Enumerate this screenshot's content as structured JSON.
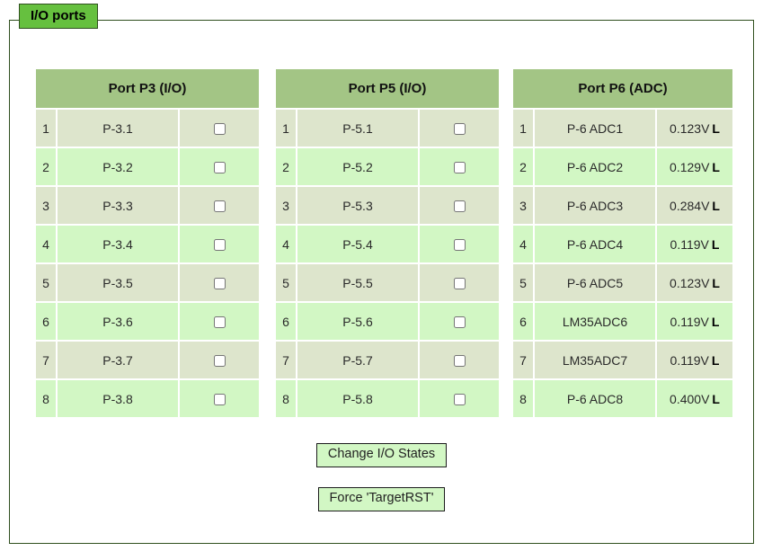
{
  "fieldset": {
    "legend": "I/O ports"
  },
  "tables": [
    {
      "id": "p3",
      "title": "Port P3 (I/O)",
      "type": "io",
      "rows": [
        {
          "index": "1",
          "name": "P-3.1",
          "checked": false
        },
        {
          "index": "2",
          "name": "P-3.2",
          "checked": false
        },
        {
          "index": "3",
          "name": "P-3.3",
          "checked": false
        },
        {
          "index": "4",
          "name": "P-3.4",
          "checked": false
        },
        {
          "index": "5",
          "name": "P-3.5",
          "checked": false
        },
        {
          "index": "6",
          "name": "P-3.6",
          "checked": false
        },
        {
          "index": "7",
          "name": "P-3.7",
          "checked": false
        },
        {
          "index": "8",
          "name": "P-3.8",
          "checked": false
        }
      ]
    },
    {
      "id": "p5",
      "title": "Port P5 (I/O)",
      "type": "io",
      "rows": [
        {
          "index": "1",
          "name": "P-5.1",
          "checked": false
        },
        {
          "index": "2",
          "name": "P-5.2",
          "checked": false
        },
        {
          "index": "3",
          "name": "P-5.3",
          "checked": false
        },
        {
          "index": "4",
          "name": "P-5.4",
          "checked": false
        },
        {
          "index": "5",
          "name": "P-5.5",
          "checked": false
        },
        {
          "index": "6",
          "name": "P-5.6",
          "checked": false
        },
        {
          "index": "7",
          "name": "P-5.7",
          "checked": false
        },
        {
          "index": "8",
          "name": "P-5.8",
          "checked": false
        }
      ]
    },
    {
      "id": "p6",
      "title": "Port P6 (ADC)",
      "type": "adc",
      "rows": [
        {
          "index": "1",
          "name": "P-6 ADC1",
          "voltage": "0.123V",
          "level": "L"
        },
        {
          "index": "2",
          "name": "P-6 ADC2",
          "voltage": "0.129V",
          "level": "L"
        },
        {
          "index": "3",
          "name": "P-6 ADC3",
          "voltage": "0.284V",
          "level": "L"
        },
        {
          "index": "4",
          "name": "P-6 ADC4",
          "voltage": "0.119V",
          "level": "L"
        },
        {
          "index": "5",
          "name": "P-6 ADC5",
          "voltage": "0.123V",
          "level": "L"
        },
        {
          "index": "6",
          "name": "LM35ADC6",
          "voltage": "0.119V",
          "level": "L"
        },
        {
          "index": "7",
          "name": "LM35ADC7",
          "voltage": "0.119V",
          "level": "L"
        },
        {
          "index": "8",
          "name": "P-6 ADC8",
          "voltage": "0.400V",
          "level": "L"
        }
      ]
    }
  ],
  "buttons": [
    {
      "id": "change-io-states",
      "label": "Change I/O States"
    },
    {
      "id": "force-target-rst",
      "label": "Force 'TargetRST'"
    }
  ],
  "colors": {
    "legend_bg": "#66c03f",
    "fieldset_border": "#2f4f1e",
    "header_bg": "#a3c585",
    "row_odd_bg": "#dde5cc",
    "row_even_bg": "#d2f7c4",
    "button_bg": "#d2f7c4"
  }
}
